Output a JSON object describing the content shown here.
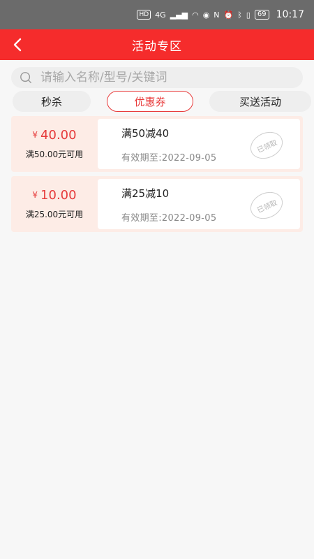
{
  "status": {
    "left_icons": [
      "HD",
      "4G"
    ],
    "time": "10:17",
    "battery": "69"
  },
  "header": {
    "title": "活动专区"
  },
  "search": {
    "placeholder": "请输入名称/型号/关键词"
  },
  "tabs": [
    {
      "label": "秒杀",
      "active": false
    },
    {
      "label": "优惠券",
      "active": true
    },
    {
      "label": "买送活动",
      "active": false
    }
  ],
  "coupons": [
    {
      "currency": "¥",
      "amount": "40.00",
      "condition": "满50.00元可用",
      "name": "满50减40",
      "expiry": "有效期至:2022-09-05",
      "stamp": "已领取"
    },
    {
      "currency": "¥",
      "amount": "10.00",
      "condition": "满25.00元可用",
      "name": "满25减10",
      "expiry": "有效期至:2022-09-05",
      "stamp": "已领取"
    }
  ],
  "colors": {
    "header_bg": "#f52c2c",
    "accent": "#e63b3b",
    "coupon_bg": "#fdece6"
  }
}
